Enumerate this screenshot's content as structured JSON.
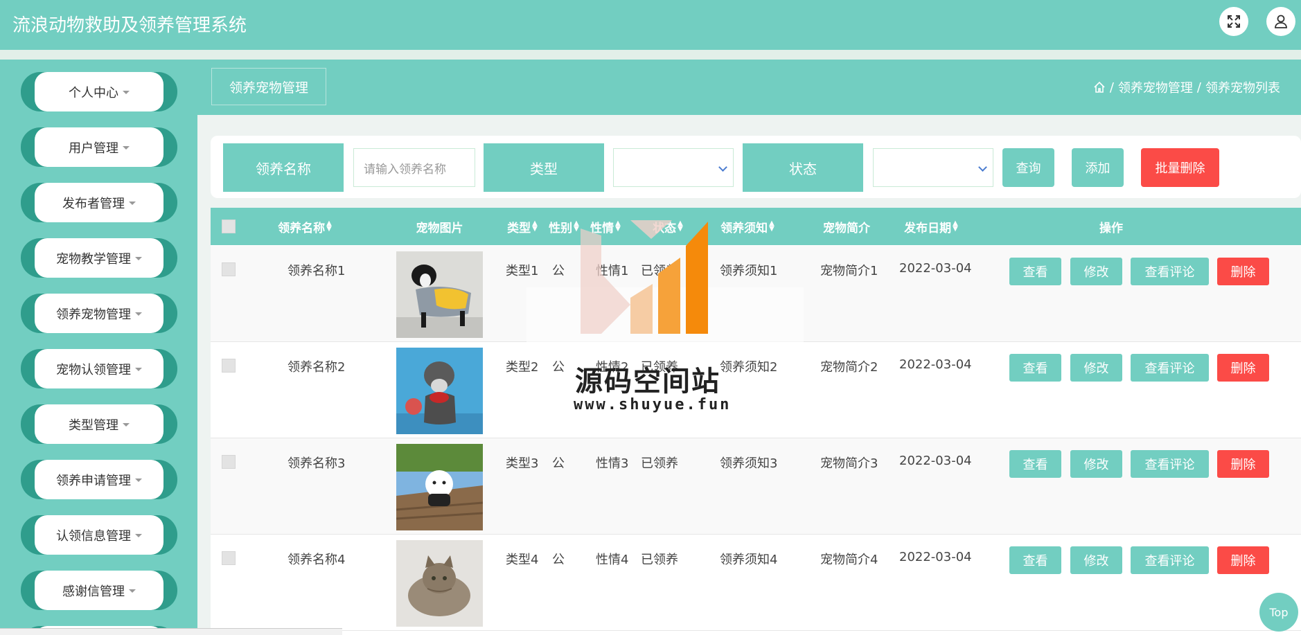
{
  "header": {
    "title": "流浪动物救助及领养管理系统",
    "fullscreen_icon": "expand-icon",
    "user_icon": "user-icon"
  },
  "sidebar": {
    "items": [
      {
        "label": "个人中心"
      },
      {
        "label": "用户管理"
      },
      {
        "label": "发布者管理"
      },
      {
        "label": "宠物教学管理"
      },
      {
        "label": "领养宠物管理"
      },
      {
        "label": "宠物认领管理"
      },
      {
        "label": "类型管理"
      },
      {
        "label": "领养申请管理"
      },
      {
        "label": "认领信息管理"
      },
      {
        "label": "感谢信管理"
      }
    ]
  },
  "breadcrumb": {
    "page_title": "领养宠物管理",
    "sep": "/",
    "level1": "领养宠物管理",
    "level2": "领养宠物列表"
  },
  "search": {
    "name_label": "领养名称",
    "name_placeholder": "请输入领养名称",
    "type_label": "类型",
    "status_label": "状态",
    "query_button": "查询",
    "add_button": "添加",
    "batch_delete_button": "批量删除"
  },
  "table": {
    "columns": [
      "领养名称",
      "宠物图片",
      "类型",
      "性别",
      "性情",
      "状态",
      "领养须知",
      "宠物简介",
      "发布日期",
      "操作"
    ],
    "rows": [
      {
        "name": "领养名称1",
        "type": "类型1",
        "gender": "公",
        "temper": "性情1",
        "status": "已领养",
        "notice": "领养须知1",
        "intro": "宠物简介1",
        "date": "2022-03-04"
      },
      {
        "name": "领养名称2",
        "type": "类型2",
        "gender": "公",
        "temper": "性情2",
        "status": "已领养",
        "notice": "领养须知2",
        "intro": "宠物简介2",
        "date": "2022-03-04"
      },
      {
        "name": "领养名称3",
        "type": "类型3",
        "gender": "公",
        "temper": "性情3",
        "status": "已领养",
        "notice": "领养须知3",
        "intro": "宠物简介3",
        "date": "2022-03-04"
      },
      {
        "name": "领养名称4",
        "type": "类型4",
        "gender": "公",
        "temper": "性情4",
        "status": "已领养",
        "notice": "领养须知4",
        "intro": "宠物简介4",
        "date": "2022-03-04"
      }
    ],
    "actions": {
      "view": "查看",
      "edit": "修改",
      "comments": "查看评论",
      "delete": "删除"
    }
  },
  "top_button": "Top",
  "watermark": {
    "title": "源码空间站",
    "url": "www.shuyue.fun"
  },
  "colors": {
    "primary": "#72cec1",
    "dark": "#2f9d8c",
    "danger": "#fb4b47"
  }
}
